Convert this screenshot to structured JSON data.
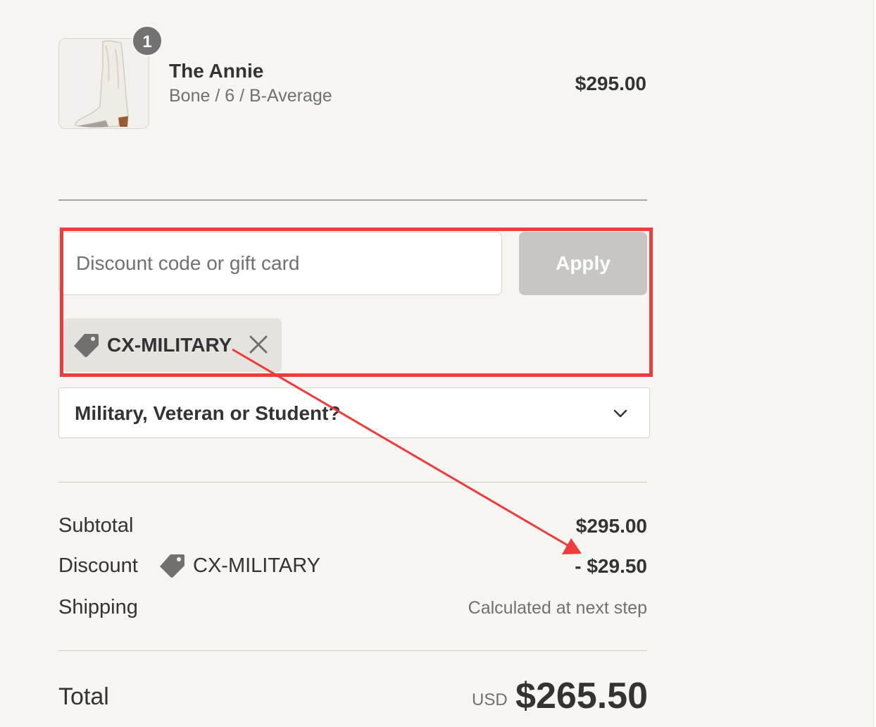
{
  "product": {
    "quantity_badge": "1",
    "name": "The Annie",
    "variant": "Bone / 6 / B-Average",
    "price": "$295.00",
    "image_icon": "boot-image"
  },
  "discount": {
    "placeholder": "Discount code or gift card",
    "apply_label": "Apply",
    "applied_code": "CX-MILITARY",
    "tag_icon": "tag-icon",
    "remove_icon": "close-icon"
  },
  "eligibility_select": {
    "selected": "Military, Veteran or Student?",
    "icon": "chevron-down-icon"
  },
  "summary": {
    "subtotal_label": "Subtotal",
    "subtotal_value": "$295.00",
    "discount_label": "Discount",
    "discount_code": "CX-MILITARY",
    "discount_value": "- $29.50",
    "shipping_label": "Shipping",
    "shipping_value": "Calculated at next step",
    "total_label": "Total",
    "currency": "USD",
    "total_value": "$265.50"
  },
  "colors": {
    "annotation": "#ee3b3b",
    "apply_button": "#c8c6c2",
    "background": "#f7f5f1"
  }
}
